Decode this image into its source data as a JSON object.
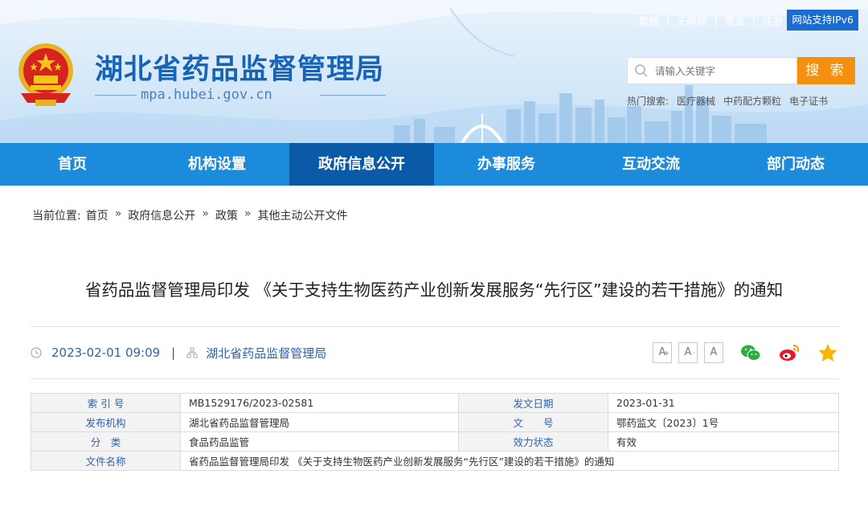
{
  "header": {
    "site_title": "湖北省药品监督管理局",
    "site_domain": "mpa.hubei.gov.cn",
    "top_links": [
      "繁體",
      "无障碍",
      "登录",
      "注册"
    ],
    "ipv6_badge": "网站支持IPv6",
    "search": {
      "placeholder": "请输入关键字",
      "button_label": "搜 索"
    },
    "hot_search": {
      "label": "热门搜索:",
      "items": [
        "医疗器械",
        "中药配方颗粒",
        "电子证书"
      ]
    }
  },
  "nav": {
    "items": [
      "首页",
      "机构设置",
      "政府信息公开",
      "办事服务",
      "互动交流",
      "部门动态"
    ],
    "active": "政府信息公开"
  },
  "breadcrumb": {
    "label": "当前位置:",
    "items": [
      "首页",
      "政府信息公开",
      "政策",
      "其他主动公开文件"
    ],
    "separator": "»"
  },
  "article": {
    "title": "省药品监督管理局印发 《关于支持生物医药产业创新发展服务“先行区”建设的若干措施》的通知",
    "datetime": "2023-02-01 09:09",
    "source": "湖北省药品监督管理局",
    "font_buttons": [
      "A",
      "A",
      "A"
    ]
  },
  "info_table": {
    "index_label": "索 引 号",
    "index_value": "MB1529176/2023-02581",
    "date_label": "发文日期",
    "date_value": "2023-01-31",
    "org_label": "发布机构",
    "org_value": "湖北省药品监督管理局",
    "docno_label": "文　　号",
    "docno_value": "鄂药监文〔2023〕1号",
    "category_label": "分　类",
    "category_value": "食品药品监管",
    "status_label": "效力状态",
    "status_value": "有效",
    "filename_label": "文件名称",
    "filename_value": "省药品监督管理局印发 《关于支持生物医药产业创新发展服务“先行区”建设的若干措施》的通知"
  },
  "colors": {
    "nav_bg": "#1d8bdc",
    "nav_active": "#0b5aa8",
    "title_blue": "#1763b8",
    "search_orange": "#f58f10",
    "link_blue": "#2b64b0",
    "ipv6_bg": "#1a6ccf"
  },
  "icons": [
    "national-emblem-icon",
    "search-icon",
    "clock-icon",
    "org-icon",
    "wechat-icon",
    "weibo-icon",
    "favorite-star-icon"
  ]
}
